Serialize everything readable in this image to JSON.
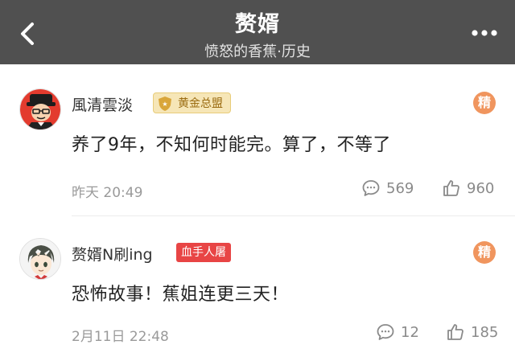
{
  "header": {
    "title": "赘婿",
    "subtitle": "愤怒的香蕉·历史"
  },
  "comments": [
    {
      "username": "風清雲淡",
      "badge": "黄金总盟",
      "featured_label": "精",
      "text": "养了9年，不知何时能完。算了，不等了",
      "time": "昨天 20:49",
      "replies": "569",
      "likes": "960"
    },
    {
      "username": "赘婿N刷ing",
      "badge": "血手人屠",
      "featured_label": "精",
      "text": "恐怖故事！蕉姐连更三天！",
      "time": "2月11日 22:48",
      "replies": "12",
      "likes": "185"
    }
  ],
  "colors": {
    "header_bg": "#505050",
    "featured_badge": "#f0955e",
    "gold_badge_bg": "#f6e6b7",
    "red_badge_bg": "#e84545",
    "meta_text": "#9a9a9a"
  },
  "icons": {
    "back": "chevron-left-icon",
    "more": "more-dots-icon",
    "reply": "comment-bubble-icon",
    "like": "thumbs-up-icon"
  }
}
